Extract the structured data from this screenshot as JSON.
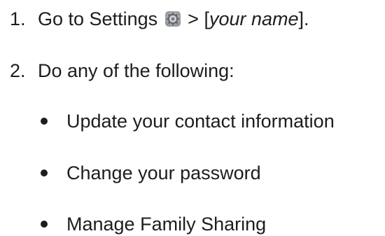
{
  "steps": [
    {
      "number": "1.",
      "prefix": "Go to Settings",
      "icon": "settings-gear-icon",
      "separator": ">",
      "bracket_open": "[",
      "placeholder": "your name",
      "bracket_close": "]."
    },
    {
      "number": "2.",
      "text": "Do any of the following:"
    }
  ],
  "options": [
    "Update your contact information",
    "Change your password",
    "Manage Family Sharing"
  ]
}
